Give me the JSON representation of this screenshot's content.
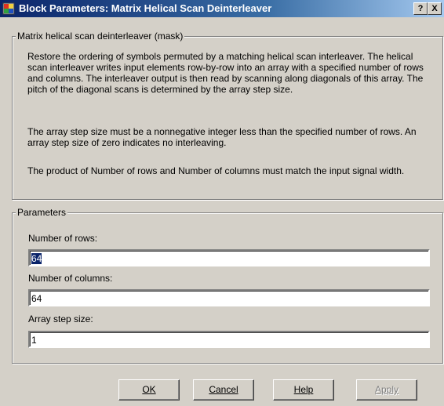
{
  "window": {
    "title": "Block Parameters: Matrix Helical Scan Deinterleaver",
    "help_label": "?",
    "close_label": "X"
  },
  "mask_group": {
    "legend": "Matrix helical scan deinterleaver (mask)",
    "paragraphs": [
      "Restore the ordering of symbols permuted by a matching helical scan interleaver. The helical scan interleaver writes input elements row-by-row into an array with a specified number of rows and columns. The interleaver output is then read by scanning along diagonals of this array. The pitch of the diagonal scans is determined by the array step size.",
      "The array step size must be a nonnegative integer less than the specified number of rows. An array step size of zero indicates no interleaving.",
      "The product of Number of rows and Number of columns must match the input signal width."
    ]
  },
  "params_group": {
    "legend": "Parameters",
    "rows_label": "Number of rows:",
    "rows_value": "64",
    "cols_label": "Number of columns:",
    "cols_value": "64",
    "step_label": "Array step size:",
    "step_value": "1"
  },
  "buttons": {
    "ok": "OK",
    "cancel": "Cancel",
    "help": "Help",
    "apply": "Apply"
  }
}
